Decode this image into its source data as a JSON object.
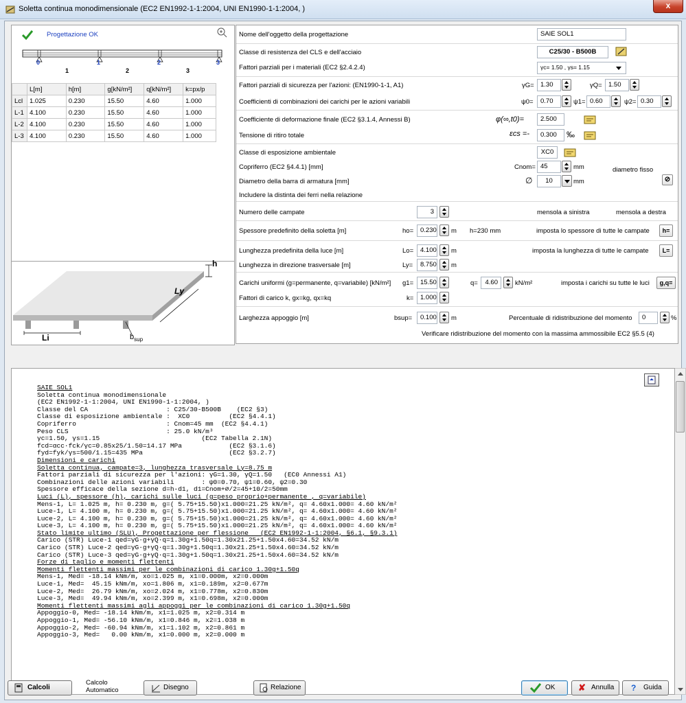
{
  "window": {
    "title": "Soletta continua monodimensionale (EC2 EN1992-1-1:2004, UNI EN1990-1-1:2004, )",
    "close": "x"
  },
  "status": {
    "text": "Progettazione OK"
  },
  "beam": {
    "supports": [
      "0",
      "1",
      "2",
      "3"
    ],
    "spans": [
      "1",
      "2",
      "3"
    ]
  },
  "table": {
    "headers": [
      "",
      "L[m]",
      "h[m]",
      "g[kN/m²]",
      "q[kN/m²]",
      "k=px/p"
    ],
    "rows": [
      [
        "Lcl",
        "1.025",
        "0.230",
        "15.50",
        "4.60",
        "1.000"
      ],
      [
        "L-1",
        "4.100",
        "0.230",
        "15.50",
        "4.60",
        "1.000"
      ],
      [
        "L-2",
        "4.100",
        "0.230",
        "15.50",
        "4.60",
        "1.000"
      ],
      [
        "L-3",
        "4.100",
        "0.230",
        "15.50",
        "4.60",
        "1.000"
      ]
    ]
  },
  "sketch": {
    "h": "h",
    "ly": "Ly",
    "li": "Li",
    "bsup": "b",
    "bsup_sub": "sup"
  },
  "form": {
    "nome_label": "Nome dell'oggetto della progettazione",
    "nome_value": "SAIE SOL1",
    "classe_label": "Classe di resistenza del CLS e dell'acciaio",
    "classe_value": "C25/30 - B500B",
    "fattori_mat_label": "Fattori parziali per i materiali (EC2 §2.4.2.4)",
    "fattori_mat_value": "γc= 1.50 , γs= 1.15",
    "fattori_az_label": "Fattori parziali di sicurezza per l'azioni: (EN1990-1-1, A1)",
    "gG_label": "γG=",
    "gG": "1.30",
    "gQ_label": "γQ=",
    "gQ": "1.50",
    "coeff_label": "Coefficienti di combinazioni dei carichi per le azioni variabili",
    "psi0_label": "ψ0=",
    "psi0": "0.70",
    "psi1_label": "ψ1=",
    "psi1": "0.60",
    "psi2_label": "ψ2=",
    "psi2": "0.30",
    "deform_label": "Coefficiente di deformazione finale (EC2 §3.1.4, Annessi B)",
    "phi_label": "φ(∞,t0)=",
    "phi": "2.500",
    "ritiro_label": "Tensione di ritiro totale",
    "ecs_label": "εcs =-",
    "ecs": "0.300",
    "ecs_unit": "‰",
    "espos_label": "Classe di esposizione ambientale",
    "espos": "XC0",
    "copri_label": "Copriferro (EC2 §4.4.1) [mm]",
    "cnom_label": "Cnom=",
    "cnom": "45",
    "cnom_unit": "mm",
    "diam_fisso": "diametro fisso",
    "diam_label": "Diametro della barra di armatura [mm]",
    "diam_sym": "∅",
    "diam": "10",
    "diam_unit": "mm",
    "distinta_label": "Includere la distinta dei ferri nella relazione",
    "campate_label": "Numero delle campate",
    "campate": "3",
    "mensola_sx": "mensola a sinistra",
    "mensola_dx": "mensola a destra",
    "spess_label": "Spessore predefinito della soletta [m]",
    "ho_label": "ho=",
    "ho": "0.230",
    "ho_unit": "m",
    "ho_mm": "h=230 mm",
    "spess_all": "imposta lo spessore di tutte le campate",
    "spess_btn": "h=",
    "luce_label": "Lunghezza predefinita della luce [m]",
    "lo_label": "Lo=",
    "lo": "4.100",
    "lo_unit": "m",
    "luce_all": "imposta la lunghezza di tutte le campate",
    "luce_btn": "L=",
    "ly_label": "Lunghezza in direzione trasversale [m]",
    "ly_lab": "Ly=",
    "ly": "8.750",
    "ly_unit": "m",
    "carichi_label": "Carichi uniformi (g=permanente, q=variabile) [kN/m²]",
    "g1_label": "g1=",
    "g1": "15.50",
    "q_label": "q=",
    "q": "4.60",
    "q_unit": "kN/m²",
    "carichi_all": "imposta i carichi su tutte le luci",
    "carichi_btn": "g,q=",
    "k_label": "Fattori di carico k, gx=kg, qx=kq",
    "k_lab": "k=",
    "k": "1.000",
    "bsup_label": "Larghezza appoggio [m]",
    "bsup_lab": "bsup=",
    "bsup": "0.100",
    "bsup_unit": "m",
    "perc_label": "Percentuale di ridistribuzione del momento",
    "perc": "0",
    "perc_unit": "%",
    "verif_label": "Verificare ridistribuzione del momento con la massima ammossibile EC2  §5.5 (4)"
  },
  "report": {
    "lines": [
      "SAIE SOL1",
      "Soletta continua monodimensionale",
      "(EC2 EN1992-1-1:2004, UNI EN1990-1-1:2004, )",
      "Classe del CA                    : C25/30-B500B    (EC2 §3)",
      "Classe di esposizione ambientale :  XC0          (EC2 §4.4.1)",
      "Copriferro                       : Cnom=45 mm  (EC2 §4.4.1)",
      "Peso CLS                         : 25.0 kN/m³",
      "γc=1.50, γs=1.15                          (EC2 Tabella 2.1N)",
      "fcd=αcc·fck/γc=0.85x25/1.50=14.17 MPa            (EC2 §3.1.6)",
      "fyd=fyk/γs=500/1.15=435 MPa                      (EC2 §3.2.7)",
      "Dimensioni e carichi",
      "Soletta continua, campate=3, lunghezza trasversale Ly=8.75 m",
      "Fattori parziali di sicurezza per l'azioni: γG=1.30, γQ=1.50   (EC0 Annessi A1)",
      "Combinazioni delle azioni variabili       : ψ0=0.70, ψ1=0.60, ψ2=0.30",
      "Spessore efficace della sezione d=h-d1, d1=Cnom+∅/2=45+10/2=50mm",
      "Luci (L), spessore (h), carichi sulle luci (g=peso proprio+permanente , q=variabile)",
      "Mens-1, L= 1.025 m, h= 0.230 m, g=( 5.75+15.50)x1.000=21.25 kN/m², q= 4.60x1.000= 4.60 kN/m²",
      "Luce-1, L= 4.100 m, h= 0.230 m, g=( 5.75+15.50)x1.000=21.25 kN/m², q= 4.60x1.000= 4.60 kN/m²",
      "Luce-2, L= 4.100 m, h= 0.230 m, g=( 5.75+15.50)x1.000=21.25 kN/m², q= 4.60x1.000= 4.60 kN/m²",
      "Luce-3, L= 4.100 m, h= 0.230 m, g=( 5.75+15.50)x1.000=21.25 kN/m², q= 4.60x1.000= 4.60 kN/m²",
      "Stato limite ultimo (SLU), Progettazione per flessione   (EC2 EN1992-1-1:2004, §6.1, §9.3.1)",
      "Carico (STR) Luce-1 qed=γG·g+γQ·q=1.30g+1.50q=1.30x21.25+1.50x4.60=34.52 kN/m",
      "Carico (STR) Luce-2 qed=γG·g+γQ·q=1.30g+1.50q=1.30x21.25+1.50x4.60=34.52 kN/m",
      "Carico (STR) Luce-3 qed=γG·g+γQ·q=1.30g+1.50q=1.30x21.25+1.50x4.60=34.52 kN/m",
      "Forze di taglio e momenti flettenti",
      "Momenti flettenti massimi per le combinazioni di carico 1.30g+1.50q",
      "Mens-1, Med= -18.14 kNm/m, xo=1.025 m, x1=0.000m, x2=0.000m",
      "Luce-1, Med=  45.15 kNm/m, xo=1.806 m, x1=0.189m, x2=0.677m",
      "Luce-2, Med=  26.79 kNm/m, xo=2.024 m, x1=0.778m, x2=0.830m",
      "Luce-3, Med=  49.94 kNm/m, xo=2.399 m, x1=0.698m, x2=0.000m",
      "Momenti flettenti massimi agli appoggi per le combinazioni di carico 1.30g+1.50q",
      "Appoggio-0, Med= -18.14 kNm/m, x1=1.025 m, x2=0.314 m",
      "Appoggio-1, Med= -56.10 kNm/m, x1=0.846 m, x2=1.038 m",
      "Appoggio-2, Med= -60.94 kNm/m, x1=1.102 m, x2=0.861 m",
      "Appoggio-3, Med=   0.00 kNm/m, x1=0.000 m, x2=0.000 m"
    ]
  },
  "buttons": {
    "calcoli": "Calcoli",
    "calcolo_auto": "Calcolo\nAutomatico",
    "disegno": "Disegno",
    "relazione": "Relazione",
    "ok": "OK",
    "annulla": "Annulla",
    "guida": "Guida"
  }
}
